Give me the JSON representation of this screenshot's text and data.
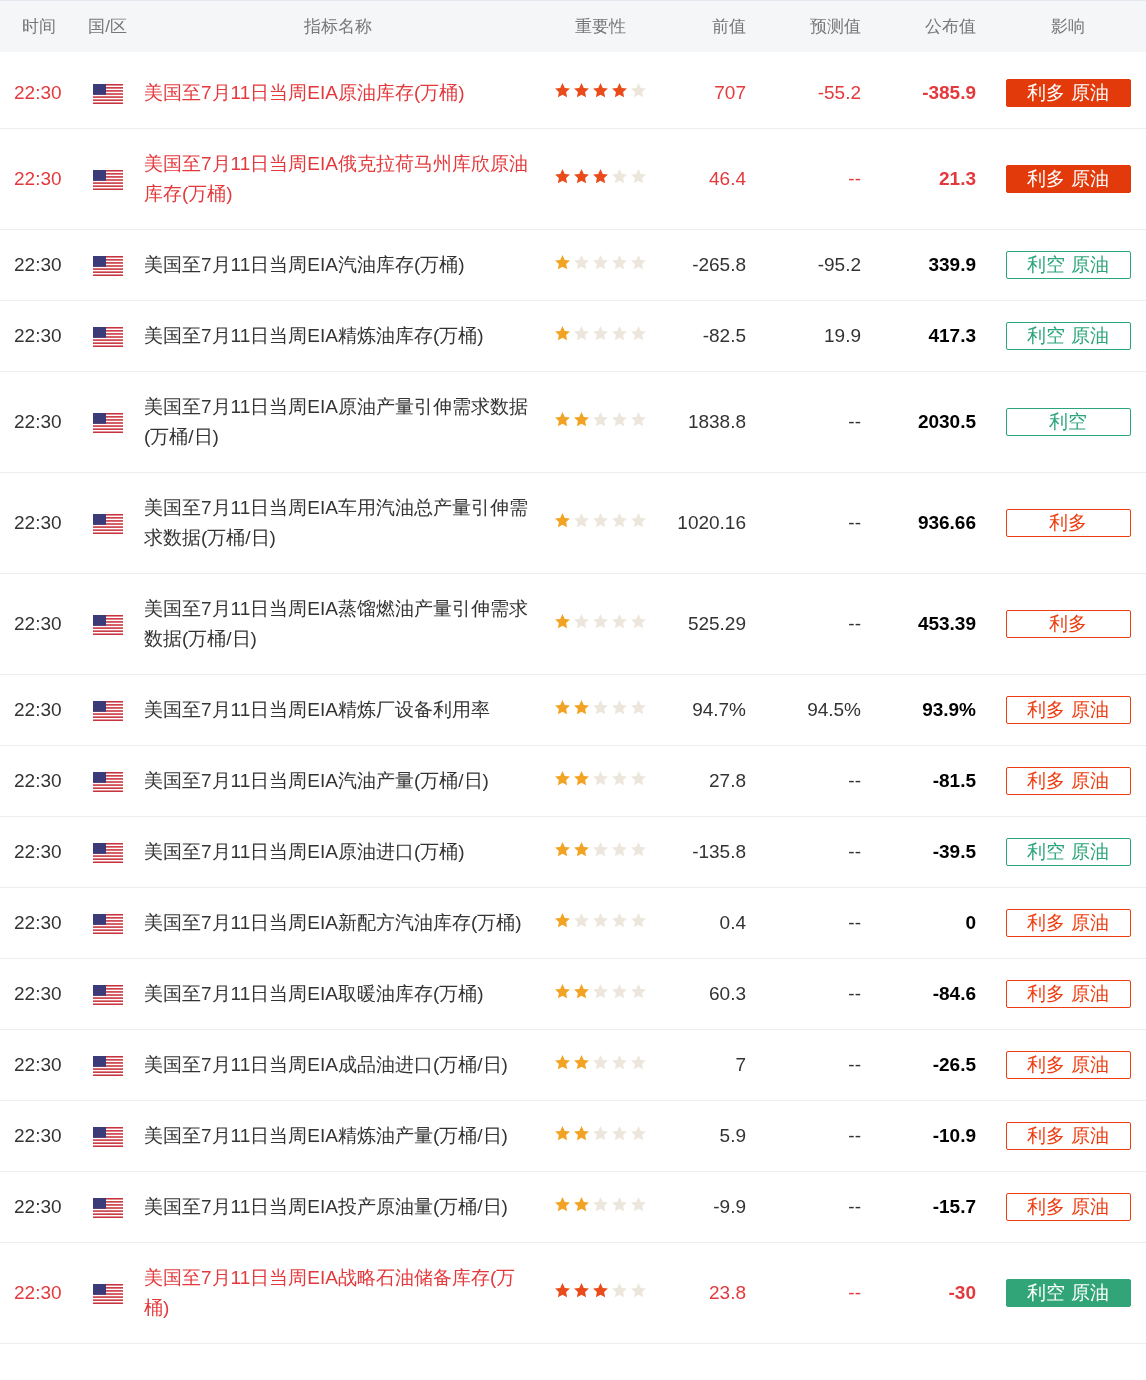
{
  "columns": [
    "时间",
    "国/区",
    "指标名称",
    "重要性",
    "前值",
    "预测值",
    "公布值",
    "影响"
  ],
  "rows": [
    {
      "time": "22:30",
      "name": "美国至7月11日当周EIA原油库存(万桶)",
      "important": true,
      "stars": 4,
      "previous": "707",
      "forecast": "-55.2",
      "actual": "-385.9",
      "impact": "利多 原油",
      "bullish": true
    },
    {
      "time": "22:30",
      "name": "美国至7月11日当周EIA俄克拉荷马州库欣原油库存(万桶)",
      "important": true,
      "stars": 3,
      "previous": "46.4",
      "forecast": "--",
      "actual": "21.3",
      "impact": "利多 原油",
      "bullish": true
    },
    {
      "time": "22:30",
      "name": "美国至7月11日当周EIA汽油库存(万桶)",
      "important": false,
      "stars": 1,
      "previous": "-265.8",
      "forecast": "-95.2",
      "actual": "339.9",
      "impact": "利空 原油",
      "bullish": false
    },
    {
      "time": "22:30",
      "name": "美国至7月11日当周EIA精炼油库存(万桶)",
      "important": false,
      "stars": 1,
      "previous": "-82.5",
      "forecast": "19.9",
      "actual": "417.3",
      "impact": "利空 原油",
      "bullish": false
    },
    {
      "time": "22:30",
      "name": "美国至7月11日当周EIA原油产量引伸需求数据(万桶/日)",
      "important": false,
      "stars": 2,
      "previous": "1838.8",
      "forecast": "--",
      "actual": "2030.5",
      "impact": "利空",
      "bullish": false
    },
    {
      "time": "22:30",
      "name": "美国至7月11日当周EIA车用汽油总产量引伸需求数据(万桶/日)",
      "important": false,
      "stars": 1,
      "previous": "1020.16",
      "forecast": "--",
      "actual": "936.66",
      "impact": "利多",
      "bullish": true
    },
    {
      "time": "22:30",
      "name": "美国至7月11日当周EIA蒸馏燃油产量引伸需求数据(万桶/日)",
      "important": false,
      "stars": 1,
      "previous": "525.29",
      "forecast": "--",
      "actual": "453.39",
      "impact": "利多",
      "bullish": true
    },
    {
      "time": "22:30",
      "name": "美国至7月11日当周EIA精炼厂设备利用率",
      "important": false,
      "stars": 2,
      "previous": "94.7%",
      "forecast": "94.5%",
      "actual": "93.9%",
      "impact": "利多 原油",
      "bullish": true
    },
    {
      "time": "22:30",
      "name": "美国至7月11日当周EIA汽油产量(万桶/日)",
      "important": false,
      "stars": 2,
      "previous": "27.8",
      "forecast": "--",
      "actual": "-81.5",
      "impact": "利多 原油",
      "bullish": true
    },
    {
      "time": "22:30",
      "name": "美国至7月11日当周EIA原油进口(万桶)",
      "important": false,
      "stars": 2,
      "previous": "-135.8",
      "forecast": "--",
      "actual": "-39.5",
      "impact": "利空 原油",
      "bullish": false
    },
    {
      "time": "22:30",
      "name": "美国至7月11日当周EIA新配方汽油库存(万桶)",
      "important": false,
      "stars": 1,
      "previous": "0.4",
      "forecast": "--",
      "actual": "0",
      "impact": "利多 原油",
      "bullish": true
    },
    {
      "time": "22:30",
      "name": "美国至7月11日当周EIA取暖油库存(万桶)",
      "important": false,
      "stars": 2,
      "previous": "60.3",
      "forecast": "--",
      "actual": "-84.6",
      "impact": "利多 原油",
      "bullish": true
    },
    {
      "time": "22:30",
      "name": "美国至7月11日当周EIA成品油进口(万桶/日)",
      "important": false,
      "stars": 2,
      "previous": "7",
      "forecast": "--",
      "actual": "-26.5",
      "impact": "利多 原油",
      "bullish": true
    },
    {
      "time": "22:30",
      "name": "美国至7月11日当周EIA精炼油产量(万桶/日)",
      "important": false,
      "stars": 2,
      "previous": "5.9",
      "forecast": "--",
      "actual": "-10.9",
      "impact": "利多 原油",
      "bullish": true
    },
    {
      "time": "22:30",
      "name": "美国至7月11日当周EIA投产原油量(万桶/日)",
      "important": false,
      "stars": 2,
      "previous": "-9.9",
      "forecast": "--",
      "actual": "-15.7",
      "impact": "利多 原油",
      "bullish": true
    },
    {
      "time": "22:30",
      "name": "美国至7月11日当周EIA战略石油储备库存(万桶)",
      "important": true,
      "stars": 3,
      "previous": "23.8",
      "forecast": "--",
      "actual": "-30",
      "impact": "利空 原油",
      "bullish": false
    }
  ]
}
